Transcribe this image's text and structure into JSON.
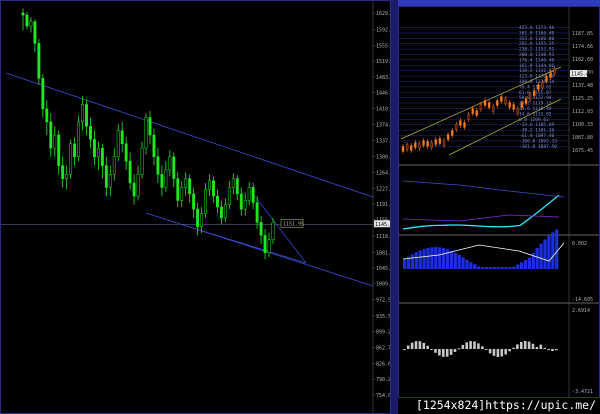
{
  "main_chart": {
    "price_labels": [
      "1629.69",
      "1592.39",
      "1555.19",
      "1519.49",
      "1483.29",
      "1446.99",
      "1410.79",
      "1374.59",
      "1337.39",
      "1300.79",
      "1264.49",
      "1227.59",
      "1191.89",
      "1156.69",
      "1118.55",
      "1081.29",
      "1045.09",
      "1009.29",
      "972.59",
      "935.59",
      "899.29",
      "862.79",
      "826.69",
      "790.29",
      "754.09"
    ],
    "current_price_tag": "1151.95",
    "current_price_axis": "1145.46",
    "candles": [
      [
        1630,
        1625,
        1640,
        1590
      ],
      [
        1625,
        1600,
        1632,
        1592
      ],
      [
        1600,
        1610,
        1620,
        1585
      ],
      [
        1610,
        1560,
        1615,
        1540
      ],
      [
        1560,
        1480,
        1570,
        1465
      ],
      [
        1480,
        1410,
        1490,
        1390
      ],
      [
        1410,
        1380,
        1430,
        1350
      ],
      [
        1380,
        1320,
        1400,
        1300
      ],
      [
        1320,
        1350,
        1370,
        1300
      ],
      [
        1350,
        1280,
        1360,
        1260
      ],
      [
        1280,
        1250,
        1300,
        1230
      ],
      [
        1250,
        1260,
        1280,
        1225
      ],
      [
        1260,
        1330,
        1340,
        1250
      ],
      [
        1330,
        1300,
        1345,
        1280
      ],
      [
        1300,
        1380,
        1395,
        1290
      ],
      [
        1380,
        1420,
        1440,
        1360
      ],
      [
        1420,
        1370,
        1430,
        1350
      ],
      [
        1370,
        1340,
        1390,
        1320
      ],
      [
        1340,
        1300,
        1360,
        1280
      ],
      [
        1300,
        1320,
        1335,
        1270
      ],
      [
        1320,
        1280,
        1330,
        1250
      ],
      [
        1280,
        1230,
        1300,
        1210
      ],
      [
        1230,
        1260,
        1280,
        1210
      ],
      [
        1260,
        1300,
        1320,
        1245
      ],
      [
        1300,
        1360,
        1375,
        1290
      ],
      [
        1360,
        1330,
        1380,
        1310
      ],
      [
        1330,
        1290,
        1345,
        1270
      ],
      [
        1290,
        1240,
        1310,
        1225
      ],
      [
        1240,
        1210,
        1260,
        1190
      ],
      [
        1210,
        1260,
        1280,
        1200
      ],
      [
        1260,
        1320,
        1335,
        1250
      ],
      [
        1320,
        1390,
        1400,
        1305
      ],
      [
        1390,
        1350,
        1405,
        1330
      ],
      [
        1350,
        1300,
        1365,
        1280
      ],
      [
        1300,
        1260,
        1320,
        1240
      ],
      [
        1260,
        1230,
        1280,
        1210
      ],
      [
        1230,
        1270,
        1290,
        1220
      ],
      [
        1270,
        1300,
        1315,
        1255
      ],
      [
        1300,
        1250,
        1310,
        1230
      ],
      [
        1250,
        1200,
        1265,
        1185
      ],
      [
        1200,
        1230,
        1245,
        1185
      ],
      [
        1230,
        1250,
        1265,
        1210
      ],
      [
        1250,
        1215,
        1260,
        1195
      ],
      [
        1215,
        1180,
        1230,
        1160
      ],
      [
        1180,
        1140,
        1195,
        1120
      ],
      [
        1140,
        1170,
        1185,
        1125
      ],
      [
        1170,
        1225,
        1240,
        1160
      ],
      [
        1225,
        1245,
        1260,
        1210
      ],
      [
        1245,
        1210,
        1255,
        1195
      ],
      [
        1210,
        1185,
        1225,
        1170
      ],
      [
        1185,
        1160,
        1200,
        1145
      ],
      [
        1160,
        1190,
        1205,
        1150
      ],
      [
        1190,
        1230,
        1245,
        1180
      ],
      [
        1230,
        1250,
        1262,
        1215
      ],
      [
        1250,
        1215,
        1258,
        1200
      ],
      [
        1215,
        1180,
        1230,
        1165
      ],
      [
        1180,
        1200,
        1218,
        1165
      ],
      [
        1200,
        1230,
        1242,
        1190
      ],
      [
        1230,
        1195,
        1240,
        1180
      ],
      [
        1195,
        1150,
        1210,
        1135
      ],
      [
        1150,
        1120,
        1165,
        1100
      ],
      [
        1120,
        1080,
        1135,
        1065
      ],
      [
        1080,
        1110,
        1125,
        1070
      ],
      [
        1110,
        1150,
        1160,
        1100
      ]
    ]
  },
  "fib_panel": {
    "levels": [
      "423.6 1173.46",
      "361.8 1166.40",
      "323.6 1160.00",
      "261.8 1155.35",
      "238.2 1152.91",
      "200.0 1148.93",
      "176.4 1146.40",
      "161.8 1144.06",
      "138.2 1141.92",
      "123.6 1139.06",
      "100.0 1136.14",
      "76.4 1129.62",
      "61.8 1125.87",
      "50.0 1122.94",
      "38.2 1119.13",
      "23.6 1116.49",
      "14.6 1111.82",
      "0.0 1109.02",
      "-23.6 1105.89",
      "-38.2 1101.36",
      "-61.8 1097.40",
      "-100.0 1092.33",
      "-161.8 1087.50"
    ],
    "axis_labels": [
      "1187.85",
      "1174.66",
      "1162.60",
      "1150.00",
      "1137.48",
      "1125.25",
      "1112.93",
      "1100.33",
      "1087.80",
      "1075.45"
    ],
    "current_price": "1145.46"
  },
  "indicator_panels": {
    "panel2_axis": [],
    "panel3_axis": [
      "0.002",
      "-14.605"
    ],
    "panel4_axis": [
      "2.6914",
      "-3.4721"
    ]
  },
  "watermark": "[1254x824]https://upic.me/"
}
